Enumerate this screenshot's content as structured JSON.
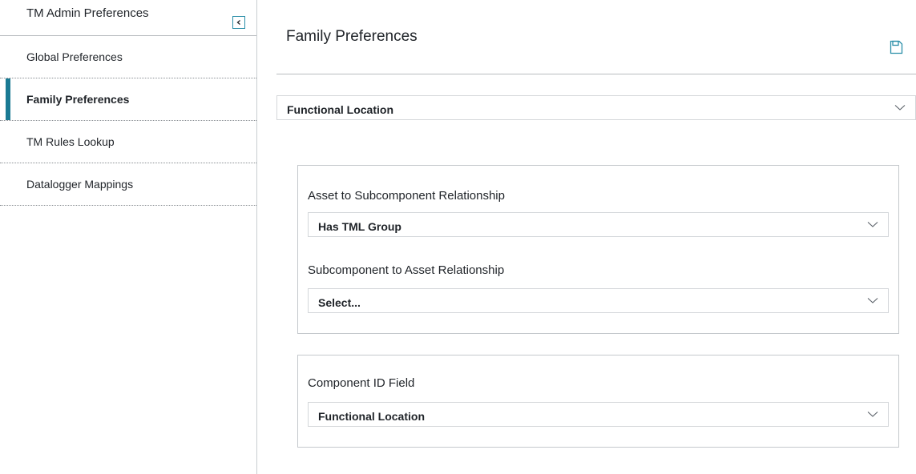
{
  "sidebar": {
    "title": "TM Admin Preferences",
    "collapse_icon": "chevron-left-icon",
    "items": [
      {
        "label": "Global Preferences",
        "active": false
      },
      {
        "label": "Family Preferences",
        "active": true
      },
      {
        "label": "TM Rules Lookup",
        "active": false
      },
      {
        "label": "Datalogger Mappings",
        "active": false
      }
    ]
  },
  "main": {
    "title": "Family Preferences",
    "save_icon": "save-icon",
    "family_select": {
      "value": "Functional Location"
    },
    "relationships": {
      "asset_to_subcomponent": {
        "label": "Asset to Subcomponent Relationship",
        "value": "Has TML Group"
      },
      "subcomponent_to_asset": {
        "label": "Subcomponent to Asset Relationship",
        "value": "Select..."
      }
    },
    "component_id": {
      "label": "Component ID Field",
      "value": "Functional Location"
    }
  },
  "colors": {
    "accent": "#1a7a93",
    "border": "#c4c8cc",
    "icon": "#2a8ea8"
  }
}
